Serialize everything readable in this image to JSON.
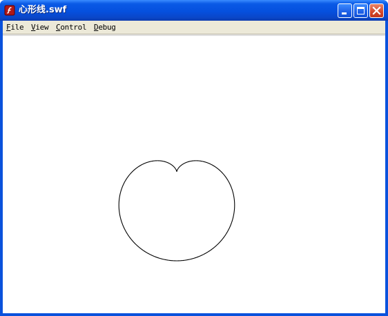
{
  "window": {
    "title": "心形线.swf",
    "app_icon": "flash-player-icon"
  },
  "title_buttons": [
    {
      "name": "minimize",
      "icon": "minimize-icon"
    },
    {
      "name": "maximize",
      "icon": "maximize-icon"
    },
    {
      "name": "close",
      "icon": "close-icon"
    }
  ],
  "menubar": {
    "items": [
      {
        "first": "F",
        "rest": "ile"
      },
      {
        "first": "V",
        "rest": "iew"
      },
      {
        "first": "C",
        "rest": "ontrol"
      },
      {
        "first": "D",
        "rest": "ebug"
      }
    ]
  },
  "canvas": {
    "shape": "cardioid",
    "stroke_color": "#000000",
    "background": "#ffffff"
  }
}
